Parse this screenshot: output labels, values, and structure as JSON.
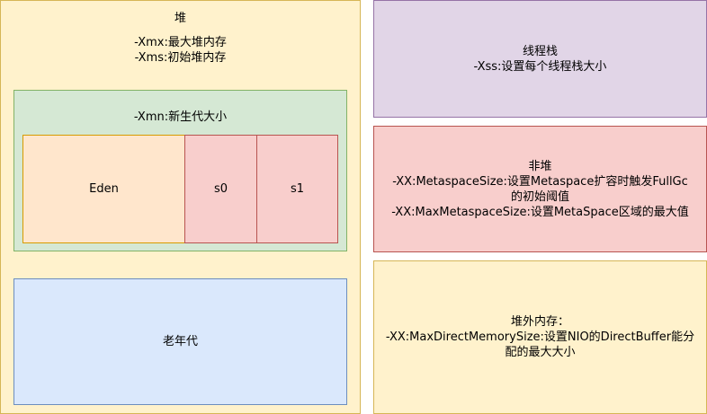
{
  "heap": {
    "title": "堆",
    "xmx": "-Xmx:最大堆内存",
    "xms": "-Xms:初始堆内存",
    "young": {
      "title": "-Xmn:新生代大小",
      "eden": "Eden",
      "s0": "s0",
      "s1": "s1"
    },
    "old": "老年代"
  },
  "thread_stack": {
    "title": "线程栈",
    "xss": "-Xss:设置每个线程栈大小"
  },
  "non_heap": {
    "title": "非堆",
    "metaspace_line1": "-XX:MetaspaceSize:设置Metaspace扩容时触发FullGc",
    "metaspace_line2": "的初始阈值",
    "max_metaspace": "-XX:MaxMetaspaceSize:设置MetaSpace区域的最大值"
  },
  "direct_memory": {
    "title": "堆外内存：",
    "line1": "-XX:MaxDirectMemorySize:设置NIO的DirectBuffer能分",
    "line2": "配的最大大小"
  }
}
